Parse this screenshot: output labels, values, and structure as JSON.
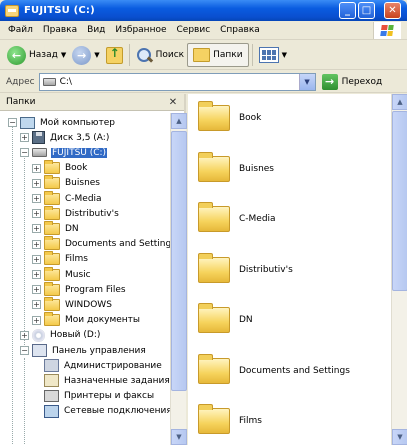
{
  "window": {
    "title": "FUJITSU (C:)",
    "minimize_glyph": "_",
    "maximize_glyph": "□",
    "close_glyph": "✕"
  },
  "menu": [
    "Файл",
    "Правка",
    "Вид",
    "Избранное",
    "Сервис",
    "Справка"
  ],
  "toolbar": {
    "back_label": "Назад",
    "forward_glyph": "→",
    "back_glyph": "←",
    "dropdown_glyph": "▼",
    "search_label": "Поиск",
    "folders_label": "Папки"
  },
  "address": {
    "label": "Адрес",
    "value": "C:\\",
    "go_label": "Переход",
    "go_glyph": "→",
    "dropdown_glyph": "▼"
  },
  "folders_pane": {
    "title": "Папки",
    "close_glyph": "✕",
    "items": [
      {
        "label": "Мой компьютер",
        "icon": "computer-icon",
        "expander": "−"
      },
      {
        "label": "Диск 3,5 (A:)",
        "icon": "floppy-icon",
        "expander": "+"
      },
      {
        "label": "FUJITSU (C:)",
        "icon": "drive-icon",
        "expander": "−",
        "selected": true
      },
      {
        "label": "Book",
        "icon": "folder-icon",
        "expander": "+"
      },
      {
        "label": "Buisnes",
        "icon": "folder-icon",
        "expander": "+"
      },
      {
        "label": "C-Media",
        "icon": "folder-icon",
        "expander": "+"
      },
      {
        "label": "Distributiv's",
        "icon": "folder-icon",
        "expander": "+"
      },
      {
        "label": "DN",
        "icon": "folder-icon",
        "expander": "+"
      },
      {
        "label": "Documents and Settings",
        "icon": "folder-icon",
        "expander": "+"
      },
      {
        "label": "Films",
        "icon": "folder-icon",
        "expander": "+"
      },
      {
        "label": "Music",
        "icon": "folder-icon",
        "expander": "+"
      },
      {
        "label": "Program Files",
        "icon": "folder-icon",
        "expander": "+"
      },
      {
        "label": "WINDOWS",
        "icon": "folder-icon",
        "expander": "+"
      },
      {
        "label": "Мои документы",
        "icon": "folder-icon",
        "expander": "+"
      },
      {
        "label": "Новый (D:)",
        "icon": "cd-icon",
        "expander": "+"
      },
      {
        "label": "Панель управления",
        "icon": "control-panel-icon",
        "expander": "−"
      },
      {
        "label": "Администрирование",
        "icon": "admin-tools-icon",
        "expander": ""
      },
      {
        "label": "Назначенные задания",
        "icon": "scheduled-tasks-icon",
        "expander": ""
      },
      {
        "label": "Принтеры и факсы",
        "icon": "printer-icon",
        "expander": ""
      },
      {
        "label": "Сетевые подключения",
        "icon": "network-icon",
        "expander": ""
      }
    ],
    "scroll_up_glyph": "▲",
    "scroll_down_glyph": "▼"
  },
  "content": {
    "items": [
      "Book",
      "Buisnes",
      "C-Media",
      "Distributiv's",
      "DN",
      "Documents and Settings",
      "Films"
    ],
    "scroll_up_glyph": "▲",
    "scroll_down_glyph": "▼"
  }
}
